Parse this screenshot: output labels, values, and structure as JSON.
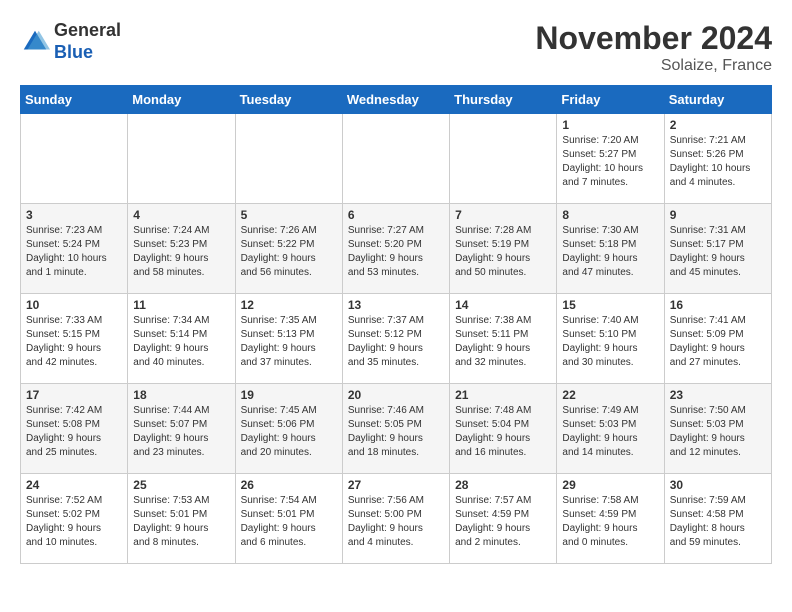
{
  "logo": {
    "general": "General",
    "blue": "Blue"
  },
  "title": "November 2024",
  "subtitle": "Solaize, France",
  "days_of_week": [
    "Sunday",
    "Monday",
    "Tuesday",
    "Wednesday",
    "Thursday",
    "Friday",
    "Saturday"
  ],
  "weeks": [
    [
      {
        "day": "",
        "info": ""
      },
      {
        "day": "",
        "info": ""
      },
      {
        "day": "",
        "info": ""
      },
      {
        "day": "",
        "info": ""
      },
      {
        "day": "",
        "info": ""
      },
      {
        "day": "1",
        "info": "Sunrise: 7:20 AM\nSunset: 5:27 PM\nDaylight: 10 hours\nand 7 minutes."
      },
      {
        "day": "2",
        "info": "Sunrise: 7:21 AM\nSunset: 5:26 PM\nDaylight: 10 hours\nand 4 minutes."
      }
    ],
    [
      {
        "day": "3",
        "info": "Sunrise: 7:23 AM\nSunset: 5:24 PM\nDaylight: 10 hours\nand 1 minute."
      },
      {
        "day": "4",
        "info": "Sunrise: 7:24 AM\nSunset: 5:23 PM\nDaylight: 9 hours\nand 58 minutes."
      },
      {
        "day": "5",
        "info": "Sunrise: 7:26 AM\nSunset: 5:22 PM\nDaylight: 9 hours\nand 56 minutes."
      },
      {
        "day": "6",
        "info": "Sunrise: 7:27 AM\nSunset: 5:20 PM\nDaylight: 9 hours\nand 53 minutes."
      },
      {
        "day": "7",
        "info": "Sunrise: 7:28 AM\nSunset: 5:19 PM\nDaylight: 9 hours\nand 50 minutes."
      },
      {
        "day": "8",
        "info": "Sunrise: 7:30 AM\nSunset: 5:18 PM\nDaylight: 9 hours\nand 47 minutes."
      },
      {
        "day": "9",
        "info": "Sunrise: 7:31 AM\nSunset: 5:17 PM\nDaylight: 9 hours\nand 45 minutes."
      }
    ],
    [
      {
        "day": "10",
        "info": "Sunrise: 7:33 AM\nSunset: 5:15 PM\nDaylight: 9 hours\nand 42 minutes."
      },
      {
        "day": "11",
        "info": "Sunrise: 7:34 AM\nSunset: 5:14 PM\nDaylight: 9 hours\nand 40 minutes."
      },
      {
        "day": "12",
        "info": "Sunrise: 7:35 AM\nSunset: 5:13 PM\nDaylight: 9 hours\nand 37 minutes."
      },
      {
        "day": "13",
        "info": "Sunrise: 7:37 AM\nSunset: 5:12 PM\nDaylight: 9 hours\nand 35 minutes."
      },
      {
        "day": "14",
        "info": "Sunrise: 7:38 AM\nSunset: 5:11 PM\nDaylight: 9 hours\nand 32 minutes."
      },
      {
        "day": "15",
        "info": "Sunrise: 7:40 AM\nSunset: 5:10 PM\nDaylight: 9 hours\nand 30 minutes."
      },
      {
        "day": "16",
        "info": "Sunrise: 7:41 AM\nSunset: 5:09 PM\nDaylight: 9 hours\nand 27 minutes."
      }
    ],
    [
      {
        "day": "17",
        "info": "Sunrise: 7:42 AM\nSunset: 5:08 PM\nDaylight: 9 hours\nand 25 minutes."
      },
      {
        "day": "18",
        "info": "Sunrise: 7:44 AM\nSunset: 5:07 PM\nDaylight: 9 hours\nand 23 minutes."
      },
      {
        "day": "19",
        "info": "Sunrise: 7:45 AM\nSunset: 5:06 PM\nDaylight: 9 hours\nand 20 minutes."
      },
      {
        "day": "20",
        "info": "Sunrise: 7:46 AM\nSunset: 5:05 PM\nDaylight: 9 hours\nand 18 minutes."
      },
      {
        "day": "21",
        "info": "Sunrise: 7:48 AM\nSunset: 5:04 PM\nDaylight: 9 hours\nand 16 minutes."
      },
      {
        "day": "22",
        "info": "Sunrise: 7:49 AM\nSunset: 5:03 PM\nDaylight: 9 hours\nand 14 minutes."
      },
      {
        "day": "23",
        "info": "Sunrise: 7:50 AM\nSunset: 5:03 PM\nDaylight: 9 hours\nand 12 minutes."
      }
    ],
    [
      {
        "day": "24",
        "info": "Sunrise: 7:52 AM\nSunset: 5:02 PM\nDaylight: 9 hours\nand 10 minutes."
      },
      {
        "day": "25",
        "info": "Sunrise: 7:53 AM\nSunset: 5:01 PM\nDaylight: 9 hours\nand 8 minutes."
      },
      {
        "day": "26",
        "info": "Sunrise: 7:54 AM\nSunset: 5:01 PM\nDaylight: 9 hours\nand 6 minutes."
      },
      {
        "day": "27",
        "info": "Sunrise: 7:56 AM\nSunset: 5:00 PM\nDaylight: 9 hours\nand 4 minutes."
      },
      {
        "day": "28",
        "info": "Sunrise: 7:57 AM\nSunset: 4:59 PM\nDaylight: 9 hours\nand 2 minutes."
      },
      {
        "day": "29",
        "info": "Sunrise: 7:58 AM\nSunset: 4:59 PM\nDaylight: 9 hours\nand 0 minutes."
      },
      {
        "day": "30",
        "info": "Sunrise: 7:59 AM\nSunset: 4:58 PM\nDaylight: 8 hours\nand 59 minutes."
      }
    ]
  ]
}
